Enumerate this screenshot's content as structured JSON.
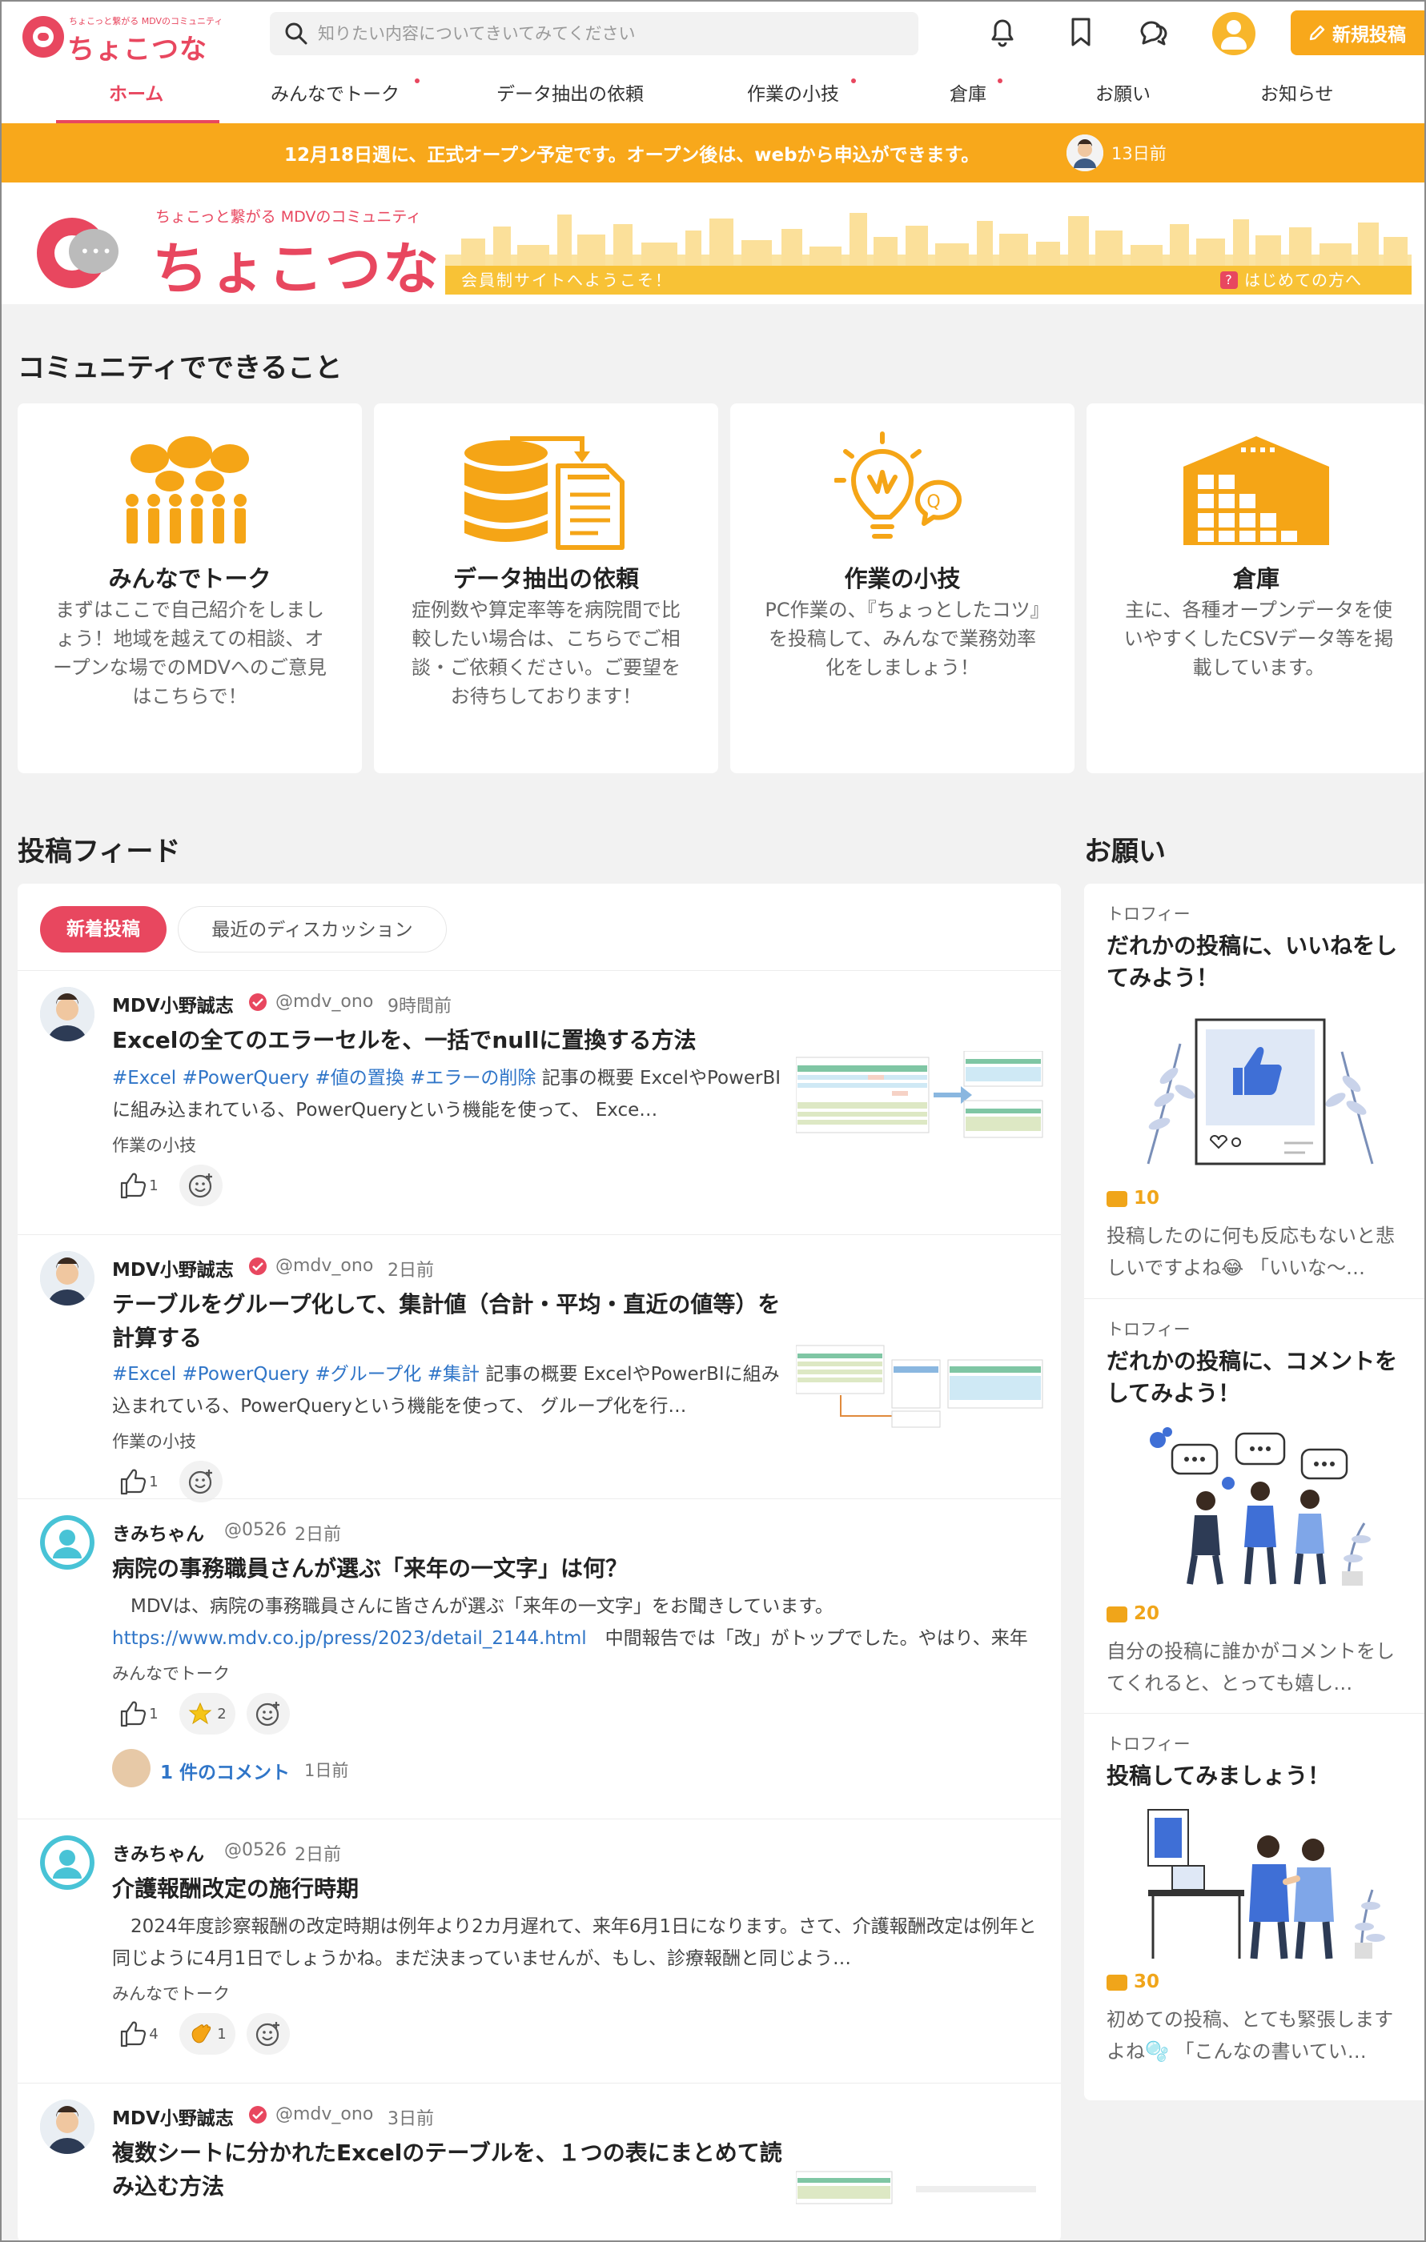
{
  "header": {
    "logo_tagline": "ちょこっと繋がる MDVのコミュニティ",
    "logo_name": "ちょこつな",
    "search_placeholder": "知りたい内容についてきいてみてください",
    "post_button": "新規投稿",
    "accent": "#e8475f",
    "brand_orange": "#f8a81b"
  },
  "nav": {
    "items": [
      {
        "label": "ホーム",
        "active": true
      },
      {
        "label": "みんなでトーク",
        "dot": true
      },
      {
        "label": "データ抽出の依頼"
      },
      {
        "label": "作業の小技",
        "dot": true
      },
      {
        "label": "倉庫",
        "dot": true
      },
      {
        "label": "お願い"
      },
      {
        "label": "お知らせ"
      }
    ]
  },
  "announcement": {
    "text": "12月18日週に、正式オープン予定です。オープン後は、webから申込ができます。",
    "time": "13日前"
  },
  "hero": {
    "tagline": "ちょこっと繋がる MDVのコミュニティ",
    "name": "ちょこつな",
    "welcome": "会員制サイトへようこそ！",
    "first_time": "はじめての方へ",
    "first_time_icon": "?"
  },
  "community": {
    "title": "コミュニティでできること",
    "cards": [
      {
        "icon": "people-talk-icon",
        "title": "みんなでトーク",
        "desc": "まずはここで自己紹介をしましょう！地域を越えての相談、オープンな場でのMDVへのご意見はこちらで！"
      },
      {
        "icon": "database-document-icon",
        "title": "データ抽出の依頼",
        "desc": "症例数や算定率等を病院間で比較したい場合は、こちらでご相談・ご依頼ください。ご要望をお待ちしております！"
      },
      {
        "icon": "lightbulb-icon",
        "title": "作業の小技",
        "desc": "PC作業の、『ちょっとしたコツ』を投稿して、みんなで業務効率化をしましょう！"
      },
      {
        "icon": "warehouse-icon",
        "title": "倉庫",
        "desc": "主に、各種オープンデータを使いやすくしたCSVデータ等を掲載しています。"
      }
    ]
  },
  "feed": {
    "title": "投稿フィード",
    "tabs": [
      "新着投稿",
      "最近のディスカッション"
    ],
    "posts": [
      {
        "author": "MDV小野誠志",
        "handle": "@mdv_ono",
        "time": "9時間前",
        "verified": true,
        "title": "Excelの全てのエラーセルを、一括でnullに置換する方法",
        "tags": "#Excel #PowerQuery #値の置換 #エラーの削除",
        "body": " 記事の概要 ExcelやPowerBIに組み込まれている、PowerQueryという機能を使って、 Exce…",
        "category": "作業の小技",
        "likes": "1"
      },
      {
        "author": "MDV小野誠志",
        "handle": "@mdv_ono",
        "time": "2日前",
        "verified": true,
        "title": "テーブルをグループ化して、集計値（合計・平均・直近の値等）を計算する",
        "tags": "#Excel #PowerQuery #グループ化 #集計",
        "body": " 記事の概要 ExcelやPowerBIに組み込まれている、PowerQueryという機能を使って、 グループ化を行…",
        "category": "作業の小技",
        "likes": "1"
      },
      {
        "author": "きみちゃん",
        "handle": "@0526",
        "time": "2日前",
        "verified": false,
        "title": "病院の事務職員さんが選ぶ「来年の一文字」は何？",
        "body": "　MDVは、病院の事務職員さんに皆さんが選ぶ「来年の一文字」をお聞きしています。",
        "link": "https://www.mdv.co.jp/press/2023/detail_2144.html",
        "body2": "　中間報告では「改」がトップでした。やはり、来年は診療…",
        "category": "みんなでトーク",
        "likes": "1",
        "stars": "2",
        "comments": "1 件のコメント",
        "comment_time": "1日前"
      },
      {
        "author": "きみちゃん",
        "handle": "@0526",
        "time": "2日前",
        "verified": false,
        "title": "介護報酬改定の施行時期",
        "body": "　2024年度診察報酬の改定時期は例年より2カ月遅れて、来年6月1日になります。さて、介護報酬改定は例年と同じように4月1日でしょうかね。まだ決まっていませんが、もし、診療報酬と同じよう…",
        "category": "みんなでトーク",
        "likes": "4",
        "claps": "1"
      },
      {
        "author": "MDV小野誠志",
        "handle": "@mdv_ono",
        "time": "3日前",
        "verified": true,
        "title": "複数シートに分かれたExcelのテーブルを、１つの表にまとめて読み込む方法"
      }
    ]
  },
  "requests": {
    "title": "お願い",
    "cards": [
      {
        "kind": "トロフィー",
        "title": "だれかの投稿に、いいねをしてみよう！",
        "coins": "10",
        "desc": "投稿したのに何も反応もないと悲しいですよね😂 「いいな〜…"
      },
      {
        "kind": "トロフィー",
        "title": "だれかの投稿に、コメントをしてみよう！",
        "coins": "20",
        "desc": "自分の投稿に誰かがコメントをしてくれると、とっても嬉し…"
      },
      {
        "kind": "トロフィー",
        "title": "投稿してみましょう！",
        "coins": "30",
        "desc": "初めての投稿、とても緊張しますよね🫧 「こんなの書いてい…"
      }
    ]
  }
}
